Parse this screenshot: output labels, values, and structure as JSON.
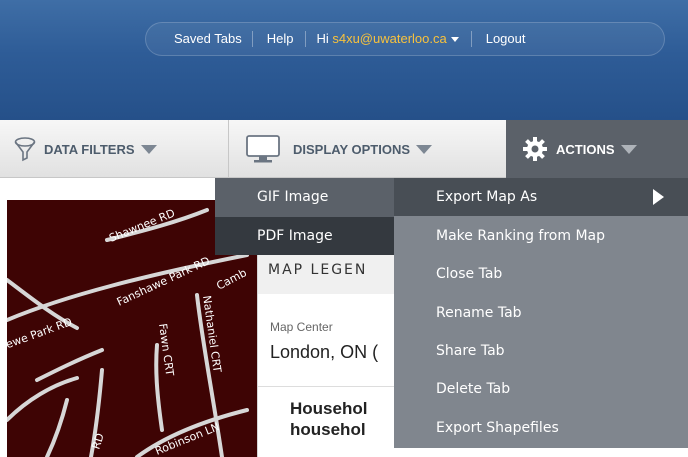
{
  "header": {
    "saved_tabs": "Saved Tabs",
    "help": "Help",
    "hi_prefix": "Hi ",
    "email": "s4xu@uwaterloo.ca",
    "logout": "Logout"
  },
  "toolbar": {
    "data_filters": "DATA FILTERS",
    "display_options": "DISPLAY OPTIONS",
    "actions": "ACTIONS"
  },
  "map": {
    "roads": [
      "Shawnee RD",
      "Fanshawe Park RD",
      "Fawn CRT",
      "Nathaniel CRT",
      "Robinson LN",
      "Camb",
      "Tewe Park RD",
      "RD"
    ]
  },
  "legend": {
    "title": "MAP LEGEN",
    "map_center_label": "Map Center",
    "map_center_value": "London, ON (",
    "heading_line1": "Househol",
    "heading_line2": "househol"
  },
  "export_submenu": {
    "items": [
      "GIF Image",
      "PDF Image"
    ]
  },
  "actions_menu": {
    "items": [
      "Export Map As",
      "Make Ranking from Map",
      "Close Tab",
      "Rename Tab",
      "Share Tab",
      "Delete Tab",
      "Export Shapefiles"
    ]
  },
  "colors": {
    "header_blue": "#2e5c97",
    "email_orange": "#f7c23d",
    "menu_dark": "#5b6169",
    "menu_light": "#80868e",
    "map_fill": "#3e0404"
  }
}
